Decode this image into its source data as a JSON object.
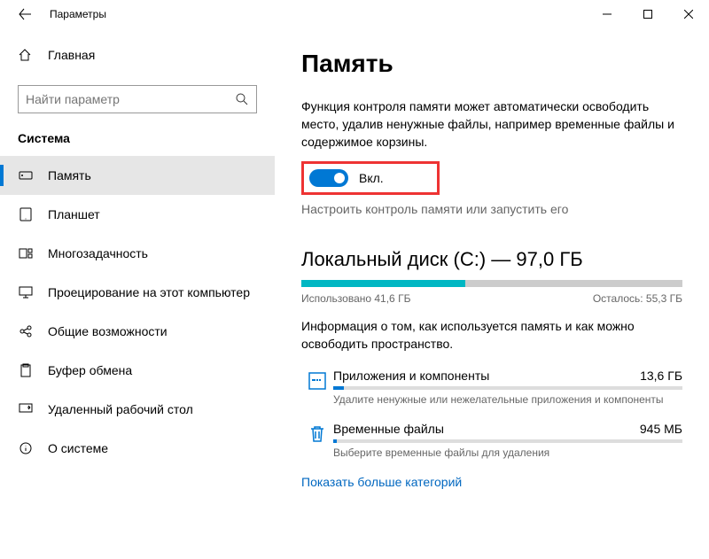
{
  "window": {
    "title": "Параметры"
  },
  "sidebar": {
    "home": "Главная",
    "search_placeholder": "Найти параметр",
    "category": "Система",
    "items": [
      {
        "label": "Память",
        "active": true
      },
      {
        "label": "Планшет"
      },
      {
        "label": "Многозадачность"
      },
      {
        "label": "Проецирование на этот компьютер"
      },
      {
        "label": "Общие возможности"
      },
      {
        "label": "Буфер обмена"
      },
      {
        "label": "Удаленный рабочий стол"
      },
      {
        "label": "О системе"
      }
    ]
  },
  "main": {
    "title": "Память",
    "description": "Функция контроля памяти может автоматически освободить место, удалив ненужные файлы, например временные файлы и содержимое корзины.",
    "toggle_label": "Вкл.",
    "configure_link": "Настроить контроль памяти или запустить его",
    "disk": {
      "title": "Локальный диск (C:) — 97,0 ГБ",
      "used_pct": 43,
      "used": "Использовано 41,6 ГБ",
      "free": "Осталось: 55,3 ГБ",
      "desc": "Информация о том, как используется память и как можно освободить пространство."
    },
    "categories": [
      {
        "name": "Приложения и компоненты",
        "size": "13,6 ГБ",
        "hint": "Удалите ненужные или нежелательные приложения и компоненты",
        "fill_pct": 3
      },
      {
        "name": "Временные файлы",
        "size": "945 МБ",
        "hint": "Выберите временные файлы для удаления",
        "fill_pct": 1
      }
    ],
    "show_more": "Показать больше категорий"
  }
}
